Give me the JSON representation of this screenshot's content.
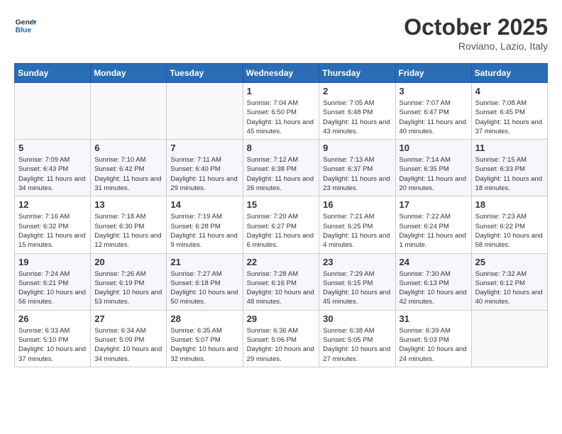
{
  "header": {
    "logo_line1": "General",
    "logo_line2": "Blue",
    "month": "October 2025",
    "location": "Roviano, Lazio, Italy"
  },
  "weekdays": [
    "Sunday",
    "Monday",
    "Tuesday",
    "Wednesday",
    "Thursday",
    "Friday",
    "Saturday"
  ],
  "weeks": [
    [
      {
        "day": "",
        "info": ""
      },
      {
        "day": "",
        "info": ""
      },
      {
        "day": "",
        "info": ""
      },
      {
        "day": "1",
        "info": "Sunrise: 7:04 AM\nSunset: 6:50 PM\nDaylight: 11 hours and 45 minutes."
      },
      {
        "day": "2",
        "info": "Sunrise: 7:05 AM\nSunset: 6:48 PM\nDaylight: 11 hours and 43 minutes."
      },
      {
        "day": "3",
        "info": "Sunrise: 7:07 AM\nSunset: 6:47 PM\nDaylight: 11 hours and 40 minutes."
      },
      {
        "day": "4",
        "info": "Sunrise: 7:08 AM\nSunset: 6:45 PM\nDaylight: 11 hours and 37 minutes."
      }
    ],
    [
      {
        "day": "5",
        "info": "Sunrise: 7:09 AM\nSunset: 6:43 PM\nDaylight: 11 hours and 34 minutes."
      },
      {
        "day": "6",
        "info": "Sunrise: 7:10 AM\nSunset: 6:42 PM\nDaylight: 11 hours and 31 minutes."
      },
      {
        "day": "7",
        "info": "Sunrise: 7:11 AM\nSunset: 6:40 PM\nDaylight: 11 hours and 29 minutes."
      },
      {
        "day": "8",
        "info": "Sunrise: 7:12 AM\nSunset: 6:38 PM\nDaylight: 11 hours and 26 minutes."
      },
      {
        "day": "9",
        "info": "Sunrise: 7:13 AM\nSunset: 6:37 PM\nDaylight: 11 hours and 23 minutes."
      },
      {
        "day": "10",
        "info": "Sunrise: 7:14 AM\nSunset: 6:35 PM\nDaylight: 11 hours and 20 minutes."
      },
      {
        "day": "11",
        "info": "Sunrise: 7:15 AM\nSunset: 6:33 PM\nDaylight: 11 hours and 18 minutes."
      }
    ],
    [
      {
        "day": "12",
        "info": "Sunrise: 7:16 AM\nSunset: 6:32 PM\nDaylight: 11 hours and 15 minutes."
      },
      {
        "day": "13",
        "info": "Sunrise: 7:18 AM\nSunset: 6:30 PM\nDaylight: 11 hours and 12 minutes."
      },
      {
        "day": "14",
        "info": "Sunrise: 7:19 AM\nSunset: 6:28 PM\nDaylight: 11 hours and 9 minutes."
      },
      {
        "day": "15",
        "info": "Sunrise: 7:20 AM\nSunset: 6:27 PM\nDaylight: 11 hours and 6 minutes."
      },
      {
        "day": "16",
        "info": "Sunrise: 7:21 AM\nSunset: 6:25 PM\nDaylight: 11 hours and 4 minutes."
      },
      {
        "day": "17",
        "info": "Sunrise: 7:22 AM\nSunset: 6:24 PM\nDaylight: 11 hours and 1 minute."
      },
      {
        "day": "18",
        "info": "Sunrise: 7:23 AM\nSunset: 6:22 PM\nDaylight: 10 hours and 58 minutes."
      }
    ],
    [
      {
        "day": "19",
        "info": "Sunrise: 7:24 AM\nSunset: 6:21 PM\nDaylight: 10 hours and 56 minutes."
      },
      {
        "day": "20",
        "info": "Sunrise: 7:26 AM\nSunset: 6:19 PM\nDaylight: 10 hours and 53 minutes."
      },
      {
        "day": "21",
        "info": "Sunrise: 7:27 AM\nSunset: 6:18 PM\nDaylight: 10 hours and 50 minutes."
      },
      {
        "day": "22",
        "info": "Sunrise: 7:28 AM\nSunset: 6:16 PM\nDaylight: 10 hours and 48 minutes."
      },
      {
        "day": "23",
        "info": "Sunrise: 7:29 AM\nSunset: 6:15 PM\nDaylight: 10 hours and 45 minutes."
      },
      {
        "day": "24",
        "info": "Sunrise: 7:30 AM\nSunset: 6:13 PM\nDaylight: 10 hours and 42 minutes."
      },
      {
        "day": "25",
        "info": "Sunrise: 7:32 AM\nSunset: 6:12 PM\nDaylight: 10 hours and 40 minutes."
      }
    ],
    [
      {
        "day": "26",
        "info": "Sunrise: 6:33 AM\nSunset: 5:10 PM\nDaylight: 10 hours and 37 minutes."
      },
      {
        "day": "27",
        "info": "Sunrise: 6:34 AM\nSunset: 5:09 PM\nDaylight: 10 hours and 34 minutes."
      },
      {
        "day": "28",
        "info": "Sunrise: 6:35 AM\nSunset: 5:07 PM\nDaylight: 10 hours and 32 minutes."
      },
      {
        "day": "29",
        "info": "Sunrise: 6:36 AM\nSunset: 5:06 PM\nDaylight: 10 hours and 29 minutes."
      },
      {
        "day": "30",
        "info": "Sunrise: 6:38 AM\nSunset: 5:05 PM\nDaylight: 10 hours and 27 minutes."
      },
      {
        "day": "31",
        "info": "Sunrise: 6:39 AM\nSunset: 5:03 PM\nDaylight: 10 hours and 24 minutes."
      },
      {
        "day": "",
        "info": ""
      }
    ]
  ]
}
